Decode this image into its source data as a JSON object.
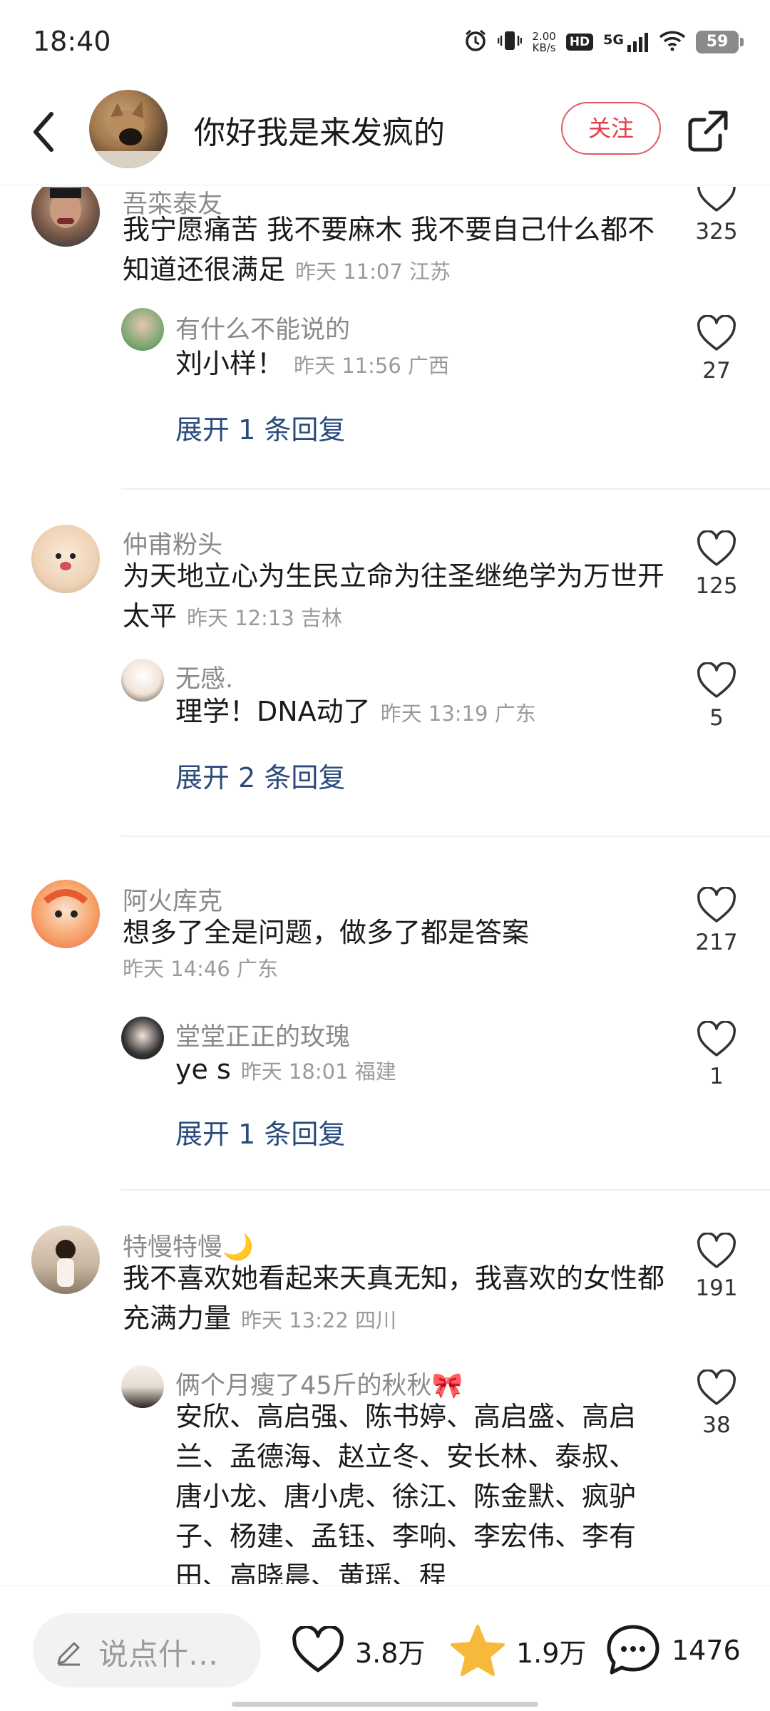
{
  "status_bar": {
    "time": "18:40",
    "net_speed_value": "2.00",
    "net_speed_unit": "KB/s",
    "hd_label": "HD",
    "network_label": "5G",
    "battery": "59",
    "icons": [
      "alarm-icon",
      "vibrate-icon",
      "signal-icon",
      "wifi-icon",
      "battery-icon"
    ]
  },
  "header": {
    "title": "你好我是来发疯的",
    "follow_label": "关注",
    "icons": [
      "back-arrow-icon",
      "share-icon"
    ]
  },
  "comments": [
    {
      "username": "吾栾泰友",
      "text": "我宁愿痛苦 我不要麻木 我不要自己什么都不知道还很满足",
      "time": "昨天 11:07",
      "location": "江苏",
      "likes": "325",
      "reply": {
        "username": "有什么不能说的",
        "text": "刘小样！",
        "time": "昨天 11:56",
        "location": "广西",
        "likes": "27"
      },
      "expand_label": "展开 1 条回复"
    },
    {
      "username": "仲甫粉头",
      "text": "为天地立心为生民立命为往圣继绝学为万世开太平",
      "time": "昨天 12:13",
      "location": "吉林",
      "likes": "125",
      "reply": {
        "username": "无感.",
        "text": "理学！DNA动了",
        "time": "昨天 13:19",
        "location": "广东",
        "likes": "5"
      },
      "expand_label": "展开 2 条回复"
    },
    {
      "username": "阿火库克",
      "text": "想多了全是问题，做多了都是答案",
      "time": "昨天 14:46",
      "location": "广东",
      "likes": "217",
      "reply": {
        "username": "堂堂正正的玫瑰",
        "text": "ye s",
        "time": "昨天 18:01",
        "location": "福建",
        "likes": "1"
      },
      "expand_label": "展开 1 条回复"
    },
    {
      "username": "特慢特慢🌙",
      "text": "我不喜欢她看起来天真无知，我喜欢的女性都充满力量",
      "time": "昨天 13:22",
      "location": "四川",
      "likes": "191",
      "reply": {
        "username": "俩个月瘦了45斤的秋秋🎀",
        "text": "安欣、高启强、陈书婷、高启盛、高启兰、孟德海、赵立冬、安长林、泰叔、唐小龙、唐小虎、徐江、陈金默、疯驴子、杨建、孟钰、李响、李宏伟、李有田、高晓晨、黄瑶、程",
        "likes": "38"
      }
    }
  ],
  "bottom_bar": {
    "input_placeholder": "说点什…",
    "likes": "3.8万",
    "favorites": "1.9万",
    "comments": "1476",
    "accent_star": "#f6b93b"
  }
}
